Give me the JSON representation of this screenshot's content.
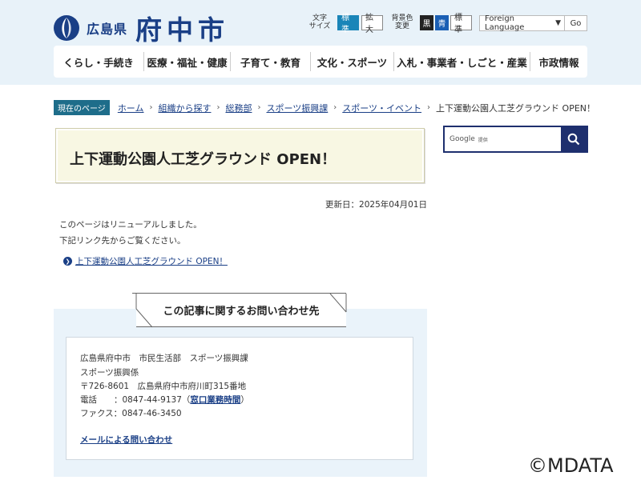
{
  "header": {
    "pref": "広島県",
    "city": "府中市",
    "text_size_label": "文字\nサイズ",
    "text_size_buttons": [
      "標準",
      "拡大"
    ],
    "bg_color_label": "背景色\n変更",
    "bg_color_buttons": [
      "黒",
      "青",
      "標準"
    ],
    "language": {
      "value": "Foreign Language",
      "go": "Go"
    }
  },
  "gnav": [
    "くらし・手続き",
    "医療・福祉・健康",
    "子育て・教育",
    "文化・スポーツ",
    "入札・事業者・しごと・産業",
    "市政情報"
  ],
  "breadcrumb": {
    "label": "現在のページ",
    "items": [
      "ホーム",
      "組織から探す",
      "総務部",
      "スポーツ振興課",
      "スポーツ・イベント"
    ],
    "current": "上下運動公園人工芝グラウンド OPEN！"
  },
  "main": {
    "title": "上下運動公園人工芝グラウンド OPEN！",
    "updated": "更新日：2025年04月01日",
    "body": [
      "このページはリニューアルしました。",
      "下記リンク先からご覧ください。"
    ],
    "link": "上下運動公園人工芝グラウンド OPEN！"
  },
  "contact": {
    "title": "この記事に関するお問い合わせ先",
    "dept": "広島県府中市　市民生活部　スポーツ振興課",
    "section": "スポーツ振興係",
    "address": "〒726-8601　広島県府中市府川町315番地",
    "tel_label": "電話　　：",
    "tel": "0847-44-9137",
    "hours_link": "窓口業務時間",
    "fax": "ファクス：0847-46-3450",
    "mail_link": "メールによる問い合わせ"
  },
  "search": {
    "brand": "Google",
    "suffix": "提供"
  },
  "watermark": "©MDATA",
  "colors": {
    "accent": "#1a3f86",
    "header_bg": "#e8f2f9",
    "title_bg": "#f8f7e3",
    "contact_bg": "#eaf3fa"
  }
}
